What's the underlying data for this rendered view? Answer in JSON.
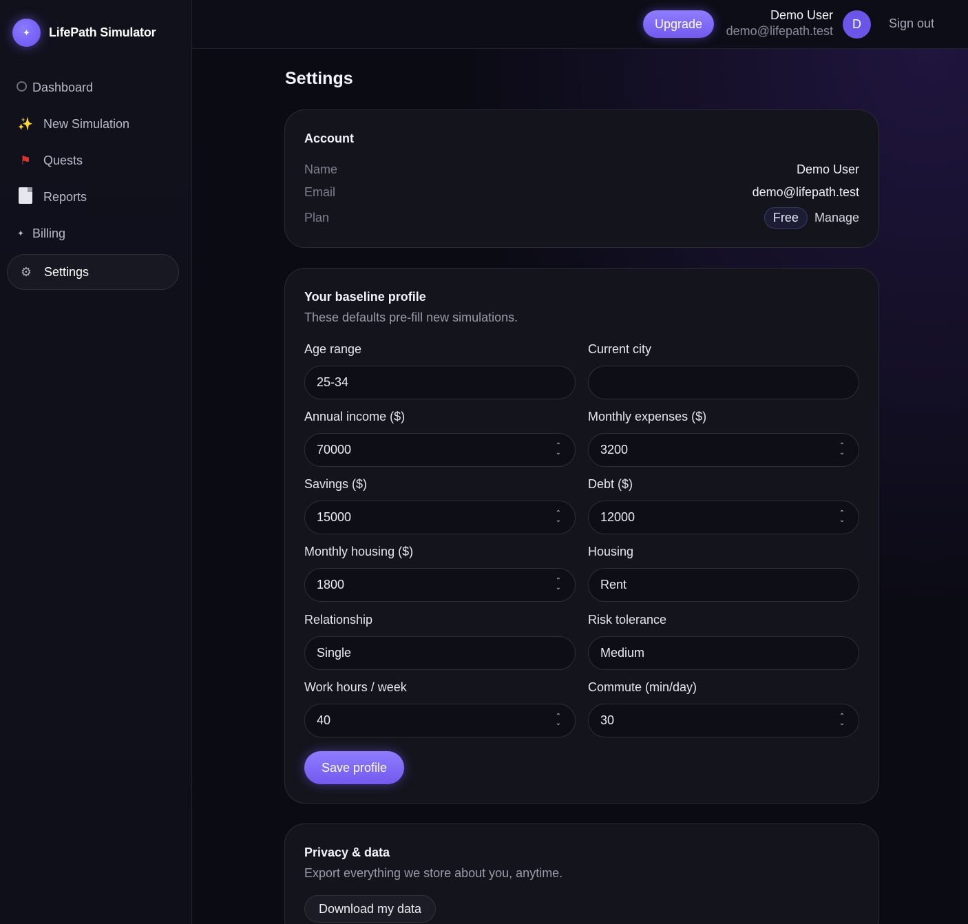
{
  "app": {
    "name": "LifePath Simulator",
    "logo_glyph": "✦"
  },
  "sidebar": {
    "items": [
      {
        "label": "Dashboard",
        "icon": "circle-icon"
      },
      {
        "label": "New Simulation",
        "icon": "sparkles-icon",
        "glyph": "✨"
      },
      {
        "label": "Quests",
        "icon": "flag-icon",
        "glyph": "🚩"
      },
      {
        "label": "Reports",
        "icon": "document-icon"
      },
      {
        "label": "Billing",
        "icon": "sparkle-icon",
        "glyph": "✦"
      },
      {
        "label": "Settings",
        "icon": "gear-icon",
        "glyph": "⚙",
        "active": true
      }
    ]
  },
  "header": {
    "upgrade_label": "Upgrade",
    "user_name": "Demo User",
    "user_email": "demo@lifepath.test",
    "avatar_initial": "D",
    "signout_label": "Sign out"
  },
  "page": {
    "title": "Settings"
  },
  "account": {
    "title": "Account",
    "name_label": "Name",
    "name_value": "Demo User",
    "email_label": "Email",
    "email_value": "demo@lifepath.test",
    "plan_label": "Plan",
    "plan_value": "Free",
    "manage_label": "Manage"
  },
  "profile": {
    "title": "Your baseline profile",
    "subtitle": "These defaults pre-fill new simulations.",
    "fields": {
      "age_range": {
        "label": "Age range",
        "value": "25-34"
      },
      "current_city": {
        "label": "Current city",
        "value": ""
      },
      "annual_income": {
        "label": "Annual income ($)",
        "value": "70000"
      },
      "monthly_expenses": {
        "label": "Monthly expenses ($)",
        "value": "3200"
      },
      "savings": {
        "label": "Savings ($)",
        "value": "15000"
      },
      "debt": {
        "label": "Debt ($)",
        "value": "12000"
      },
      "monthly_housing": {
        "label": "Monthly housing ($)",
        "value": "1800"
      },
      "housing": {
        "label": "Housing",
        "value": "Rent"
      },
      "relationship": {
        "label": "Relationship",
        "value": "Single"
      },
      "risk_tolerance": {
        "label": "Risk tolerance",
        "value": "Medium"
      },
      "work_hours": {
        "label": "Work hours / week",
        "value": "40"
      },
      "commute": {
        "label": "Commute (min/day)",
        "value": "30"
      }
    },
    "save_label": "Save profile"
  },
  "privacy": {
    "title": "Privacy & data",
    "subtitle": "Export everything we store about you, anytime.",
    "download_label": "Download my data"
  },
  "colors": {
    "accent": "#7c66f5",
    "background": "#0b0b14",
    "card": "#14141d"
  }
}
